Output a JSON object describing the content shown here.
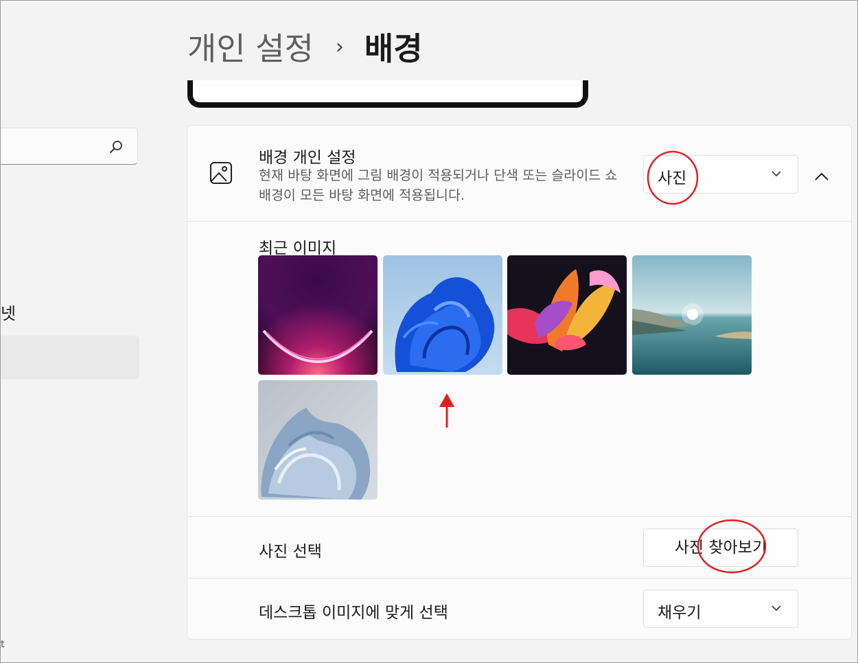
{
  "header": {
    "parent": "개인 설정",
    "separator": "›",
    "current": "배경"
  },
  "sidebar": {
    "partial_item": "넷",
    "bottom_mark": "t"
  },
  "background": {
    "title": "배경 개인 설정",
    "description": "현재 바탕 화면에 그림 배경이 적용되거나 단색 또는 슬라이드 쇼 배경이 모든 바탕 화면에 적용됩니다.",
    "type_value": "사진"
  },
  "recent": {
    "label": "최근 이미지",
    "count": 5
  },
  "choose_photo": {
    "label": "사진 선택",
    "button": "사진 찾아보기"
  },
  "fit": {
    "label": "데스크톱 이미지에 맞게 선택",
    "value": "채우기"
  },
  "annotation_color": "#e0201f"
}
